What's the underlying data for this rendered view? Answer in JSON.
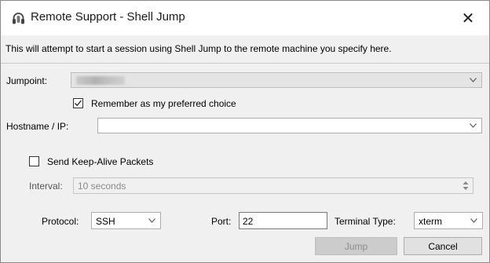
{
  "window": {
    "title": "Remote Support - Shell Jump",
    "close_glyph": "✕"
  },
  "description": "This will attempt to start a session using Shell Jump to the remote machine you specify here.",
  "jumpoint": {
    "label": "Jumpoint:",
    "value_redacted": true
  },
  "remember": {
    "label": "Remember as my preferred choice",
    "checked": true
  },
  "hostname": {
    "label": "Hostname / IP:",
    "value": ""
  },
  "keepalive": {
    "label": "Send Keep-Alive Packets",
    "checked": false
  },
  "interval": {
    "label": "Interval:",
    "value": "10 seconds",
    "enabled": false
  },
  "protocol": {
    "label": "Protocol:",
    "value": "SSH"
  },
  "port": {
    "label": "Port:",
    "value": "22"
  },
  "terminal": {
    "label": "Terminal Type:",
    "value": "xterm"
  },
  "buttons": {
    "jump": "Jump",
    "cancel": "Cancel"
  },
  "icons": {
    "app": "headset-icon",
    "close": "close-icon"
  },
  "colors": {
    "dialog_bg": "#f0f0f0",
    "disabled_text": "#8c8c8c"
  }
}
